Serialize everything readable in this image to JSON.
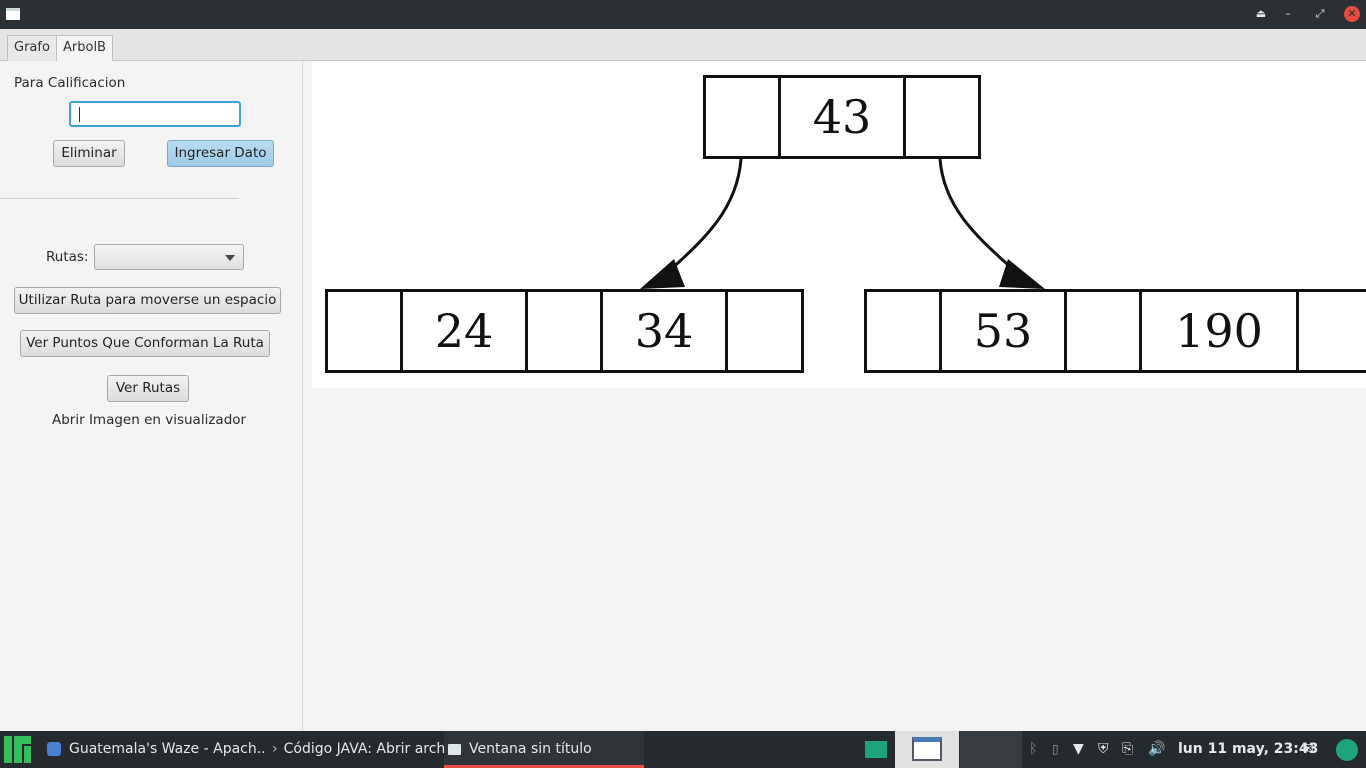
{
  "window": {
    "buttons": {
      "minimize": "–",
      "maximize": "⤢",
      "close": "✕",
      "eject": "⏏"
    }
  },
  "tabs": [
    {
      "label": "Grafo"
    },
    {
      "label": "ArbolB"
    }
  ],
  "left_panel": {
    "calificacion_label": "Para Calificacion",
    "input_value": "",
    "eliminar_button": "Eliminar",
    "ingresar_button": "Ingresar Dato",
    "rutas_label": "Rutas:",
    "rutas_selected": "",
    "utilizar_ruta_button": "Utilizar Ruta para moverse un espacio",
    "ver_puntos_button": "Ver Puntos Que Conforman La Ruta",
    "ver_rutas_button": "Ver Rutas",
    "abrir_imagen_label": "Abrir Imagen en visualizador"
  },
  "tree": {
    "root": {
      "keys": [
        "43"
      ]
    },
    "left_child": {
      "keys": [
        "24",
        "34"
      ]
    },
    "right_child": {
      "keys": [
        "53",
        "190"
      ]
    }
  },
  "taskbar": {
    "tasks": [
      {
        "label": "Guatemala's Waze - Apach..."
      },
      {
        "label": "Código JAVA: Abrir archi..."
      },
      {
        "label": "Ventana sin título"
      }
    ],
    "clock": "lun 11 may, 23:43",
    "accent_color": "#e54d42"
  }
}
